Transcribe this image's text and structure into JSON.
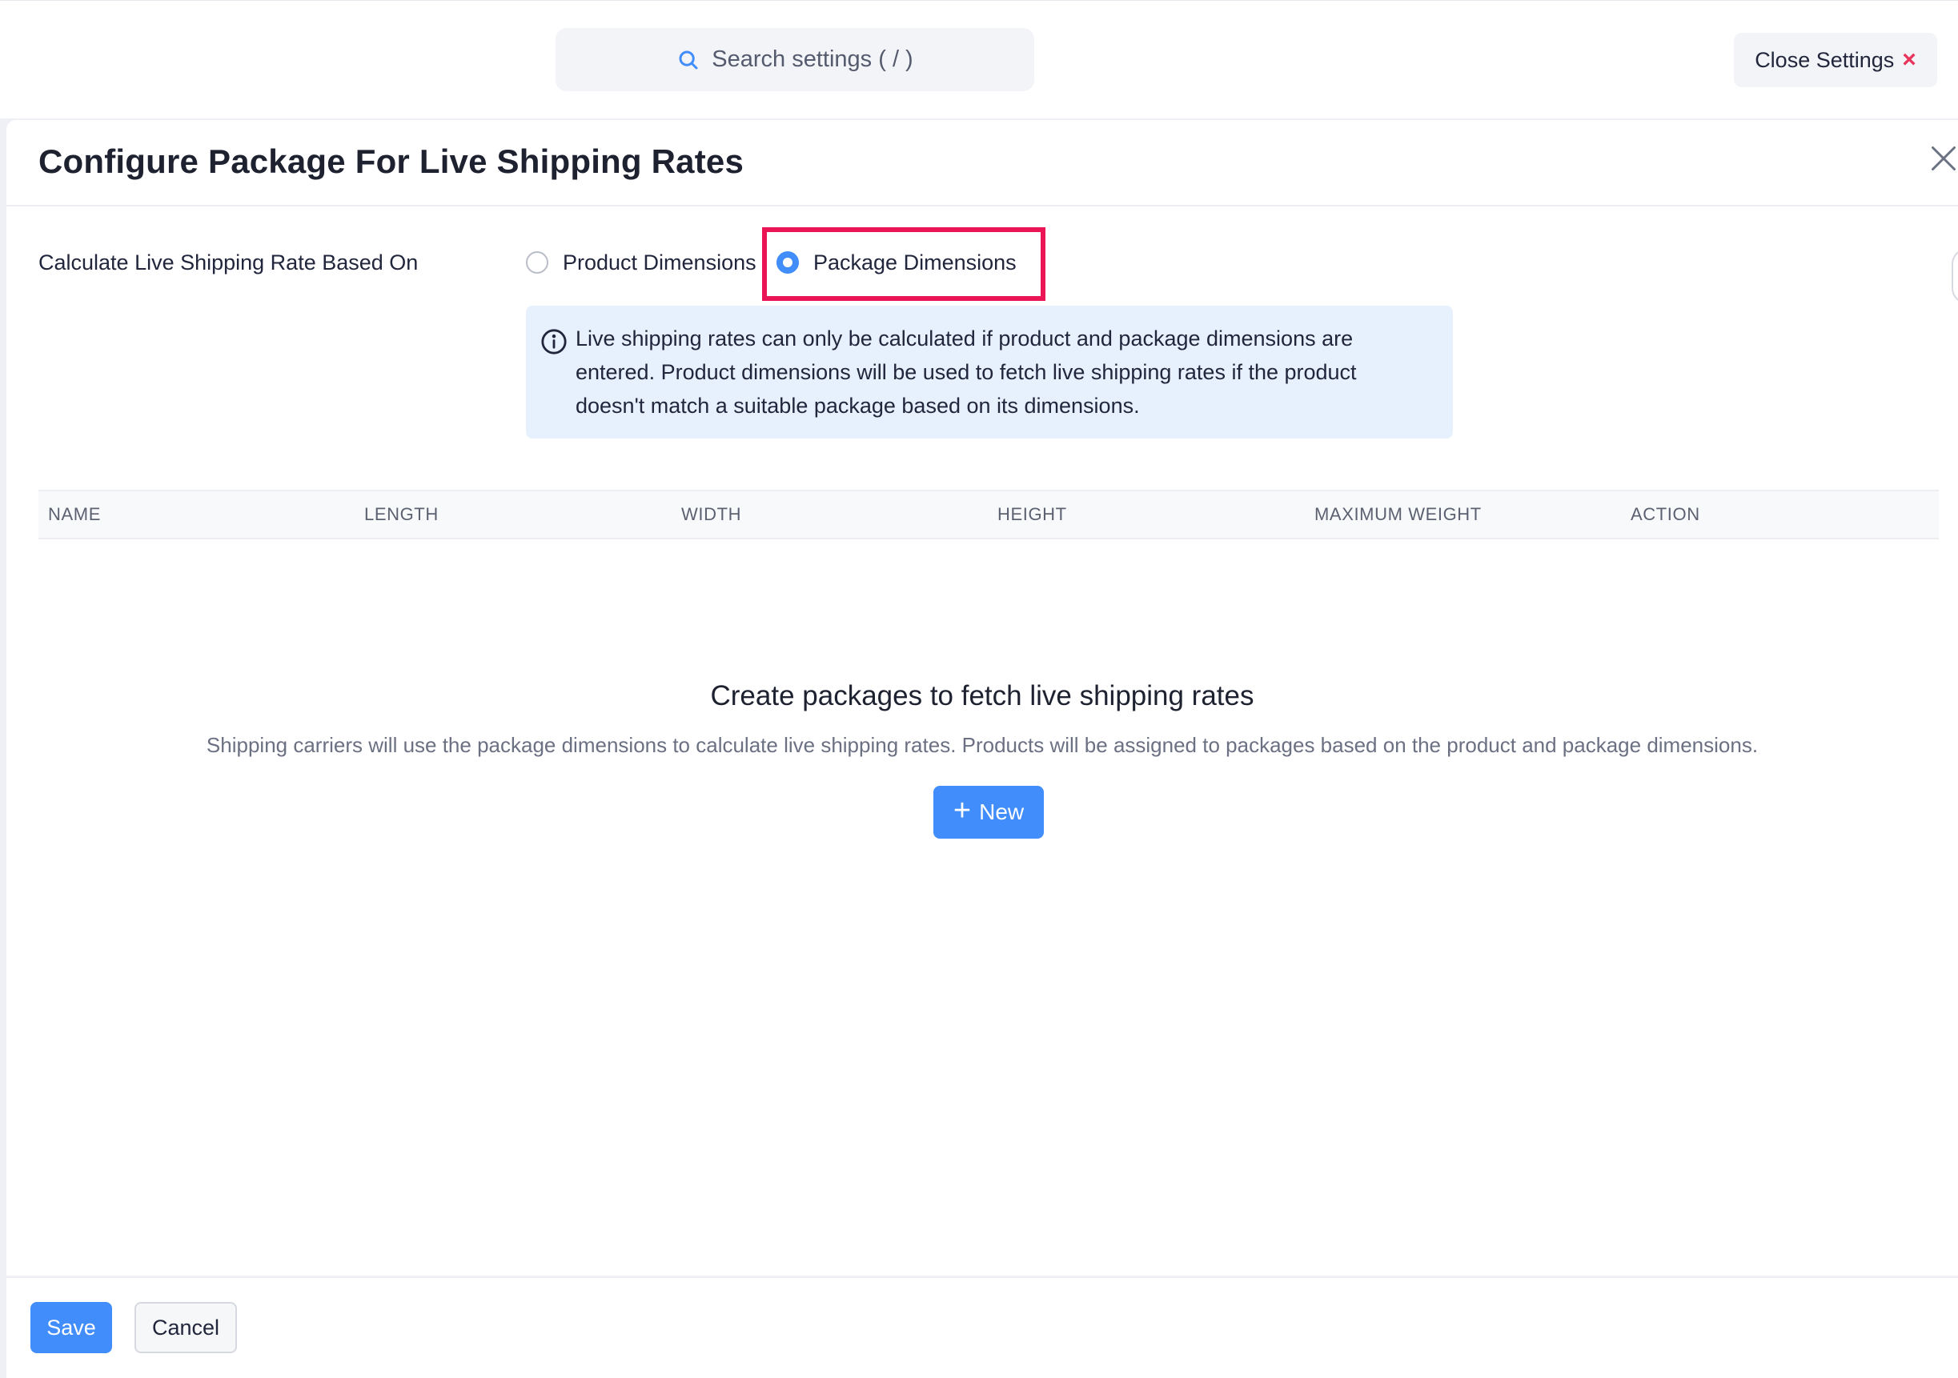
{
  "topbar": {
    "search_placeholder": "Search settings ( / )",
    "close_settings_label": "Close Settings"
  },
  "panel": {
    "title": "Configure Package For Live Shipping Rates",
    "rate_label": "Calculate Live Shipping Rate Based On",
    "options": [
      {
        "label": "Product Dimensions",
        "selected": false
      },
      {
        "label": "Package Dimensions",
        "selected": true
      }
    ],
    "info_text": "Live shipping rates can only be calculated if product and package dimensions are entered. Product dimensions will be used to fetch live shipping rates if the product doesn't match a suitable package based on its dimensions."
  },
  "table": {
    "columns": [
      "NAME",
      "LENGTH",
      "WIDTH",
      "HEIGHT",
      "MAXIMUM WEIGHT",
      "ACTION"
    ]
  },
  "empty_state": {
    "title": "Create packages to fetch live shipping rates",
    "description": "Shipping carriers will use the package dimensions to calculate live shipping rates. Products will be assigned to packages based on the product and package dimensions.",
    "new_button": "New"
  },
  "footer": {
    "save_label": "Save",
    "cancel_label": "Cancel"
  },
  "colors": {
    "accent": "#408dfb",
    "highlight": "#eb1454",
    "info_bg": "#e7f1fd",
    "close_x": "#e8335b"
  },
  "icons": {
    "search": "search-icon",
    "close_settings": "close-x-icon",
    "panel_close": "close-icon",
    "info": "info-icon",
    "new": "plus-icon"
  }
}
